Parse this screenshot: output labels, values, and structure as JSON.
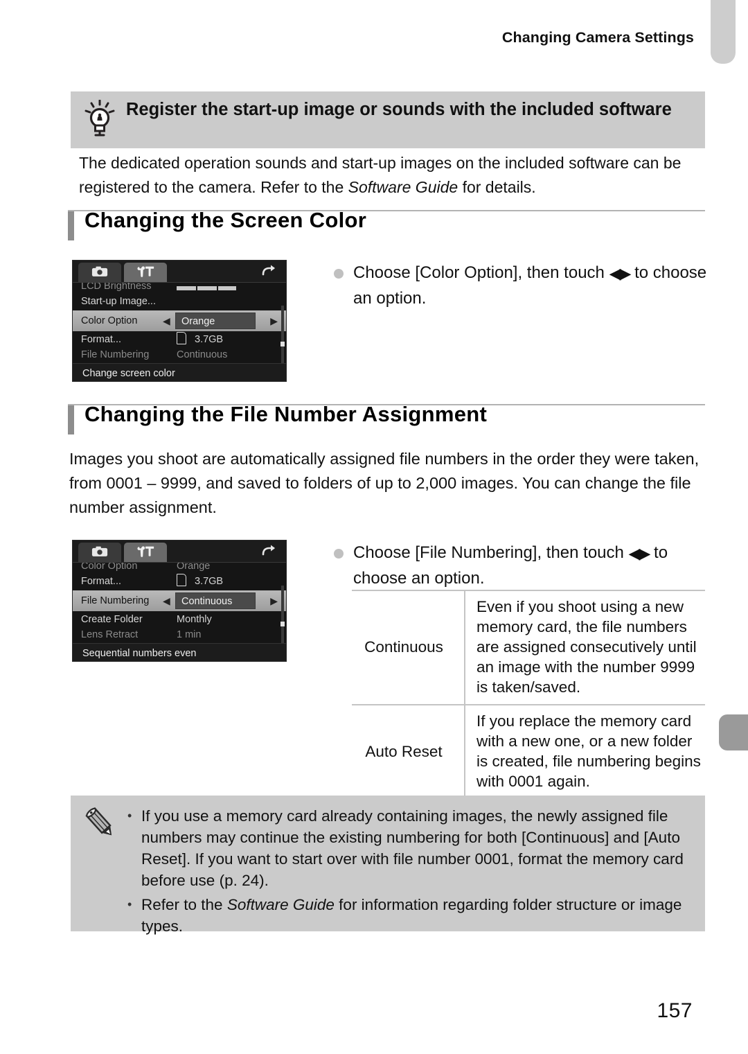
{
  "header": {
    "running_title": "Changing Camera Settings"
  },
  "margin_tabs": {
    "top_tab_color": "#cdcdcd",
    "side_tab_color": "#9a9a9a"
  },
  "tip_box": {
    "icon": "lightbulb-icon",
    "title": "Register the start-up image or sounds with the included software",
    "body_part1": "The dedicated operation sounds and start-up images on the included software can be registered to the camera. Refer to the ",
    "body_italic": "Software Guide",
    "body_part2": " for details."
  },
  "sections": [
    {
      "id": "screen-color",
      "heading": "Changing the Screen Color"
    },
    {
      "id": "file-number",
      "heading": "Changing the File Number Assignment",
      "paragraph": "Images you shoot are automatically assigned file numbers in the order they were taken, from 0001 – 9999, and saved to folders of up to 2,000 images. You can change the file number assignment."
    }
  ],
  "lcd_color": {
    "tabs": [
      {
        "icon": "camera-icon",
        "name": "shooting-tab"
      },
      {
        "icon": "wrench-hammer-icon",
        "name": "setup-tab"
      }
    ],
    "back_icon": "back-arrow-icon",
    "rows": [
      {
        "label": "LCD Brightness",
        "value": "",
        "state": "clipped-top",
        "widget": "brightness-bar"
      },
      {
        "label": "Start-up Image...",
        "value": "",
        "state": "normal"
      },
      {
        "label": "Color Option",
        "value": "Orange",
        "state": "selected"
      },
      {
        "label": "Format...",
        "value": "3.7GB",
        "state": "normal",
        "widget": "card-icon"
      },
      {
        "label": "File Numbering",
        "value": "Continuous",
        "state": "clipped-bottom"
      }
    ],
    "footer": "Change screen color"
  },
  "lcd_filenum": {
    "tabs": [
      {
        "icon": "camera-icon",
        "name": "shooting-tab"
      },
      {
        "icon": "wrench-hammer-icon",
        "name": "setup-tab"
      }
    ],
    "back_icon": "back-arrow-icon",
    "rows": [
      {
        "label": "Color Option",
        "value": "Orange",
        "state": "clipped-top"
      },
      {
        "label": "Format...",
        "value": "3.7GB",
        "state": "normal",
        "widget": "card-icon"
      },
      {
        "label": "File Numbering",
        "value": "Continuous",
        "state": "selected"
      },
      {
        "label": "Create Folder",
        "value": "Monthly",
        "state": "normal"
      },
      {
        "label": "Lens Retract",
        "value": "1 min",
        "state": "clipped-bottom"
      }
    ],
    "footer": "Sequential numbers even"
  },
  "step_color": {
    "text_before": "Choose [Color Option], then touch ",
    "arrows": "◀▶",
    "text_after": " to choose an option."
  },
  "step_filenum": {
    "text_before": "Choose [File Numbering], then touch ",
    "arrows": "◀▶",
    "text_after": " to choose an option."
  },
  "options_table": {
    "rows": [
      {
        "name": "Continuous",
        "description": "Even if you shoot using a new memory card, the file numbers are assigned consecutively until an image with the number 9999 is taken/saved."
      },
      {
        "name": "Auto Reset",
        "description": "If you replace the memory card with a new one, or a new folder is created, file numbering begins with 0001 again."
      }
    ]
  },
  "note_box": {
    "icon": "pencil-icon",
    "bullet": "•",
    "items": [
      {
        "part1": "If you use a memory card already containing images, the newly assigned file numbers may continue the existing numbering for both [Continuous] and [Auto Reset]. If you want to start over with file number 0001, format the memory card before use (p. 24).",
        "italic": "",
        "part2": ""
      },
      {
        "part1": "Refer to the ",
        "italic": "Software Guide",
        "part2": " for information regarding folder structure or image types."
      }
    ]
  },
  "footer": {
    "page_number": "157"
  }
}
